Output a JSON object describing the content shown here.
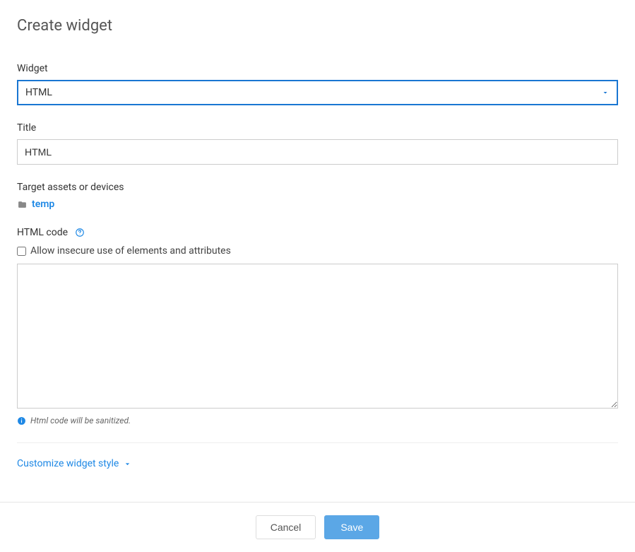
{
  "dialog": {
    "title": "Create widget"
  },
  "fields": {
    "widget": {
      "label": "Widget",
      "value": "HTML"
    },
    "title": {
      "label": "Title",
      "value": "HTML"
    },
    "target": {
      "label": "Target assets or devices",
      "link_text": "temp"
    },
    "html_code": {
      "label": "HTML code",
      "allow_insecure_label": "Allow insecure use of elements and attributes",
      "value": "",
      "sanitize_info": "Html code will be sanitized."
    },
    "customize": {
      "label": "Customize widget style"
    }
  },
  "actions": {
    "cancel": "Cancel",
    "save": "Save"
  }
}
